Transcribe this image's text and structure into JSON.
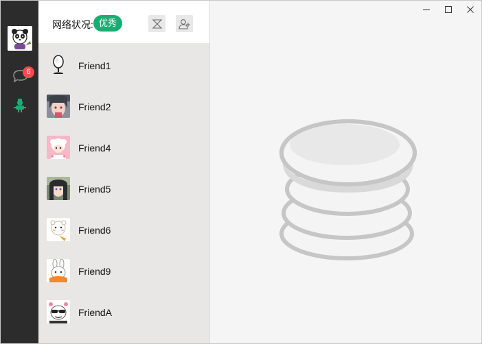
{
  "network": {
    "label": "网络状况:",
    "status": "优秀"
  },
  "navigation": {
    "unread_badge": "6"
  },
  "friends": [
    {
      "name": "Friend1",
      "avatar": "mirror-icon"
    },
    {
      "name": "Friend2",
      "avatar": "anime-girl-avatar"
    },
    {
      "name": "Friend4",
      "avatar": "pink-sheep-avatar"
    },
    {
      "name": "Friend5",
      "avatar": "anime-girl-dark-hair-avatar"
    },
    {
      "name": "Friend6",
      "avatar": "white-bear-avatar"
    },
    {
      "name": "Friend9",
      "avatar": "white-rabbit-avatar"
    },
    {
      "name": "FriendA",
      "avatar": "sunglasses-character-avatar"
    }
  ],
  "colors": {
    "accent": "#1aad73",
    "badge": "#f24c4c",
    "rail": "#2c2c2c",
    "list": "#e9e7e5"
  }
}
